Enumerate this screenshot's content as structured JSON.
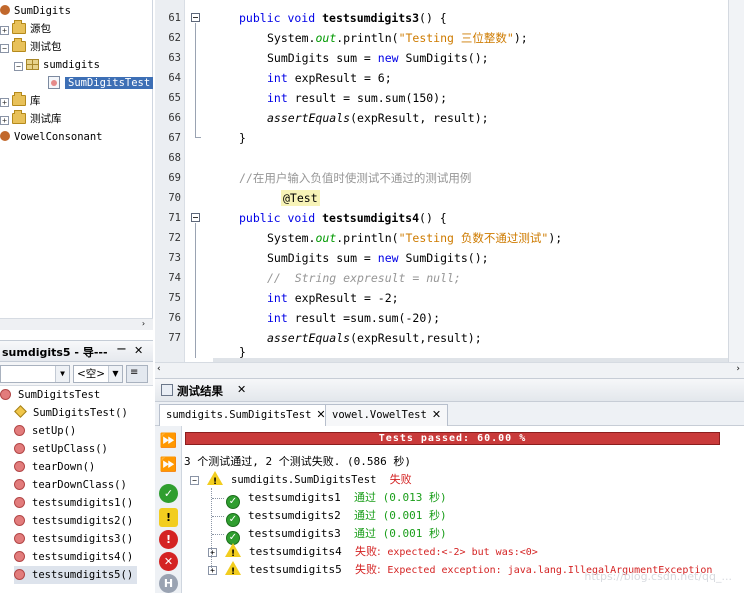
{
  "project_tree": {
    "items": [
      {
        "label": "SumDigits"
      },
      {
        "label": "源包"
      },
      {
        "label": "测试包"
      },
      {
        "label": "sumdigits"
      },
      {
        "label": "SumDigitsTest"
      },
      {
        "label": "库"
      },
      {
        "label": "测试库"
      },
      {
        "label": "VowelConsonant"
      }
    ]
  },
  "navigator": {
    "title": "sumdigits5 - 导---",
    "minimize": "−",
    "close": "✕",
    "filter_value": "<空>",
    "class_name": "SumDigitsTest",
    "members": [
      "SumDigitsTest()",
      "setUp()",
      "setUpClass()",
      "tearDown()",
      "tearDownClass()",
      "testsumdigits1()",
      "testsumdigits2()",
      "testsumdigits3()",
      "testsumdigits4()",
      "testsumdigits5()"
    ]
  },
  "editor": {
    "lines": [
      {
        "n": "61"
      },
      {
        "n": "62"
      },
      {
        "n": "63"
      },
      {
        "n": "64"
      },
      {
        "n": "65"
      },
      {
        "n": "66"
      },
      {
        "n": "67"
      },
      {
        "n": "68"
      },
      {
        "n": "69"
      },
      {
        "n": "70"
      },
      {
        "n": "71"
      },
      {
        "n": "72"
      },
      {
        "n": "73"
      },
      {
        "n": "74"
      },
      {
        "n": "75"
      },
      {
        "n": "76"
      },
      {
        "n": "77"
      }
    ],
    "code": {
      "l61_kw": "public void ",
      "l61_name": "testsumdigits3",
      "l61_rest": "() {",
      "l62_a": "System.",
      "l62_out": "out",
      "l62_b": ".println(",
      "l62_str": "\"Testing 三位整数\"",
      "l62_c": ");",
      "l63_a": "SumDigits sum = ",
      "l63_new": "new",
      "l63_b": " SumDigits();",
      "l64_kw": "int",
      "l64_rest": " expResult = 6;",
      "l65_kw": "int",
      "l65_rest": " result = sum.sum(150);",
      "l66_it": "assertEquals",
      "l66_rest": "(expResult, result);",
      "l67": "}",
      "l69_comment": "//在用户输入负值时使测试不通过的测试用例",
      "l70_ann": "@Test",
      "l71_kw": "public void ",
      "l71_name": "testsumdigits4",
      "l71_rest": "() {",
      "l72_a": "System.",
      "l72_out": "out",
      "l72_b": ".println(",
      "l72_str": "\"Testing 负数不通过测试\"",
      "l72_c": ");",
      "l73_a": "SumDigits sum = ",
      "l73_new": "new",
      "l73_b": " SumDigits();",
      "l74_comment": "//  String expresult = null;",
      "l75_kw": "int",
      "l75_rest": " expResult = -2;",
      "l76_kw": "int",
      "l76_rest": " result =sum.sum(-20);",
      "l77_it": "assertEquals",
      "l77_rest": "(expResult,result);",
      "l78": "}"
    }
  },
  "test_results": {
    "panel_title": "测试结果",
    "tabs": [
      {
        "label": "sumdigits.SumDigitsTest"
      },
      {
        "label": "vowel.VowelTest"
      }
    ],
    "progress_label": "Tests passed: 60.00 %",
    "progress_percent": 60,
    "summary": "3 个测试通过, 2 个测试失败. (0.586 秒)",
    "suite": {
      "name": "sumdigits.SumDigitsTest",
      "status": "失败"
    },
    "tests": [
      {
        "name": "testsumdigits1",
        "status": "通过",
        "detail": "(0.013 秒)"
      },
      {
        "name": "testsumdigits2",
        "status": "通过",
        "detail": "(0.001 秒)"
      },
      {
        "name": "testsumdigits3",
        "status": "通过",
        "detail": "(0.001 秒)"
      },
      {
        "name": "testsumdigits4",
        "status": "失败:",
        "detail": "expected:<-2> but was:<0>"
      },
      {
        "name": "testsumdigits5",
        "status": "失败:",
        "detail": "Expected exception: java.lang.IllegalArgumentException"
      }
    ],
    "watermark": "https://blog.csdn.net/qq_..."
  },
  "colors": {
    "progress_fail": "#c93a3a",
    "pass_green": "#1a9e1a",
    "fail_red": "#d42323",
    "selection": "#3d6fb5"
  }
}
